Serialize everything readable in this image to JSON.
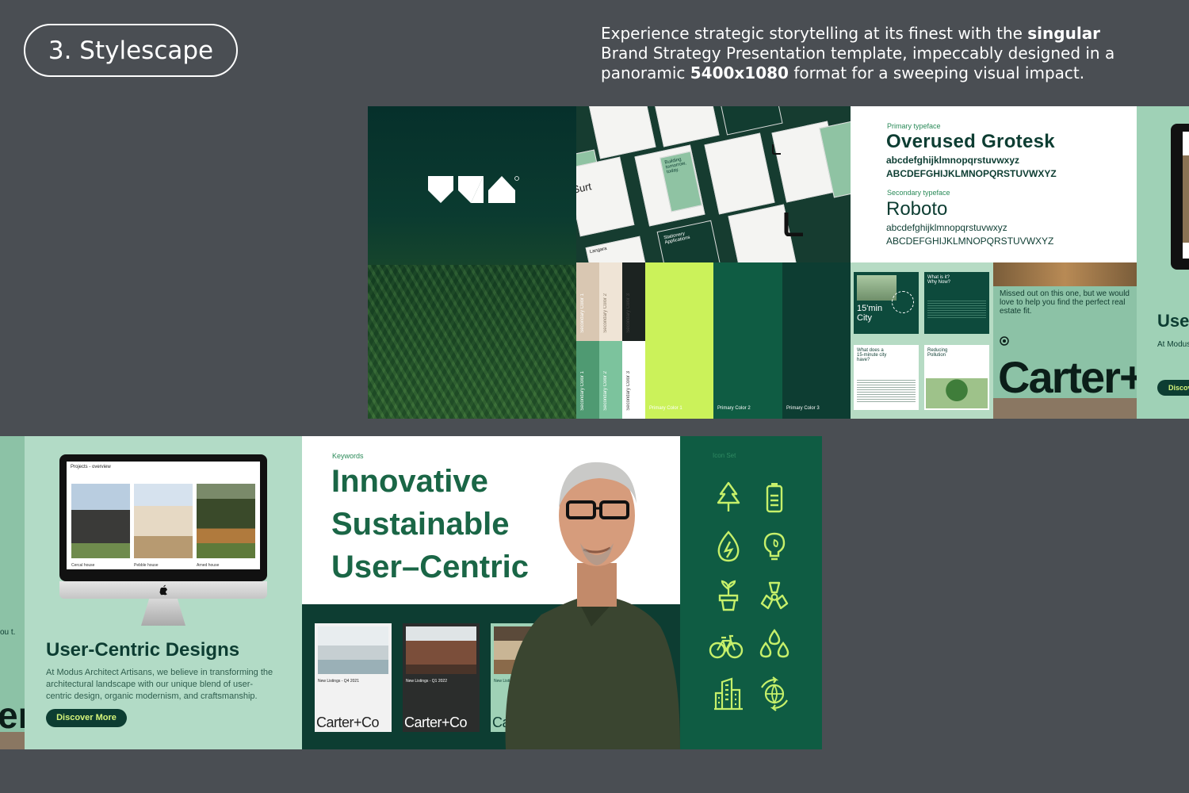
{
  "header": {
    "section_label": "3. Stylescape",
    "intro_parts": [
      "Experience strategic storytelling at its finest with the ",
      "singular",
      " Brand Strategy Presentation template, impeccably designed in a panoramic ",
      "5400x1080",
      " format for a sweeping visual impact."
    ]
  },
  "top_strip": {
    "collage": {
      "words": [
        "Surt",
        "Building tomorrow, today.",
        "Stationery Applications",
        "Langara"
      ]
    },
    "typography": {
      "primary_label": "Primary typeface",
      "primary_name": "Overused Grotesk",
      "primary_lower": "abcdefghijklmnopqrstuvwxyz",
      "primary_upper": "ABCDEFGHIJKLMNOPQRSTUVWXYZ",
      "secondary_label": "Secondary typeface",
      "secondary_name": "Roboto",
      "secondary_lower": "abcdefghijklmnopqrstuvwxyz",
      "secondary_upper": "ABCDEFGHIJKLMNOPQRSTUVWXYZ"
    },
    "palette": {
      "secondary_1": "Secondary Color 1",
      "secondary_2": "Secondary Color 2",
      "secondary_3": "Secondary Color 3",
      "primary_1": "Primary Color 1",
      "primary_2": "Primary Color 2",
      "primary_3": "Primary Color 3",
      "colors": {
        "beige": "#d9c7b2",
        "cream": "#efe4d6",
        "charcoal": "#1c2321",
        "mint": "#4f9a72",
        "mint_light": "#7cc39d",
        "white": "#ffffff",
        "lime": "#cbf25a",
        "green": "#0f5c43",
        "deep_green": "#0d3d32"
      }
    },
    "pages": {
      "p1_title": "15'min City",
      "p2_title": "What is it? Why Now?",
      "p3_title": "What does a 15-minute city have?",
      "p4_title": "Reducing Pollution"
    },
    "billboard": {
      "tagline": "Missed out on this one, but we would love to help you find the perfect real estate fit.",
      "brand": "Carter+"
    },
    "edge_panel": {
      "heading": "Use",
      "text": "At Modus architect centric d",
      "button": "Discov"
    }
  },
  "bottom_strip": {
    "edge": {
      "fragment_text": "ou t.",
      "brand_fragment": "er"
    },
    "promo": {
      "screen_title": "Projects - overview",
      "projects": [
        "Cercal house",
        "Pebble house",
        "Arned house"
      ],
      "heading": "User-Centric Designs",
      "body": "At Modus Architect Artisans, we believe in transforming the architectural landscape with our unique blend of user-centric design, organic modernism, and craftsmanship.",
      "button": "Discover More"
    },
    "keywords": {
      "label": "Keywords",
      "words": [
        "Innovative",
        "Sustainable",
        "User–Centric"
      ],
      "cards": [
        {
          "listing": "New Listings - Q4 2021",
          "brand": "Carter+Co"
        },
        {
          "listing": "New Listings - Q1 2022",
          "brand": "Carter+Co"
        },
        {
          "listing": "New Listings",
          "brand": "Ca"
        }
      ]
    },
    "icon_set": {
      "label": "Icon Set",
      "icons": [
        "tree-icon",
        "battery-icon",
        "leaf-drop-icon",
        "lightbulb-icon",
        "potted-plant-icon",
        "radiation-icon",
        "bicycle-icon",
        "water-drops-icon",
        "city-buildings-icon",
        "recycle-globe-icon"
      ],
      "icon_color": "#c6f06a"
    }
  }
}
